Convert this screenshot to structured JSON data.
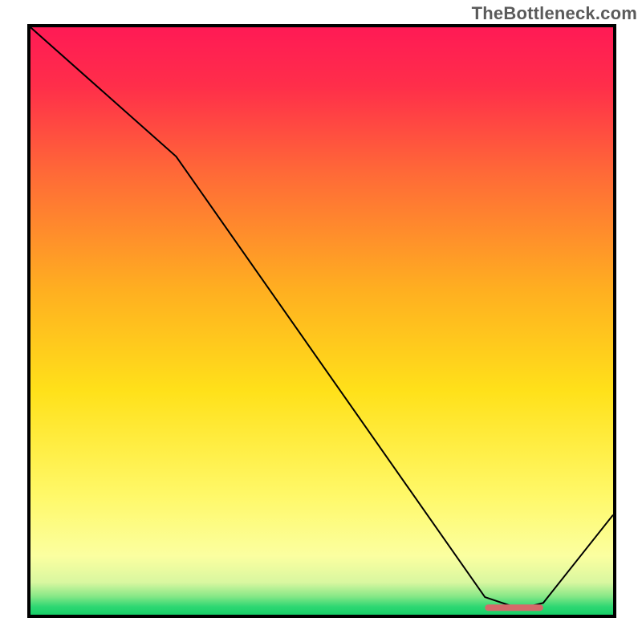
{
  "watermark": "TheBottleneck.com",
  "chart_data": {
    "type": "line",
    "title": "",
    "xlabel": "",
    "ylabel": "",
    "xlim": [
      0,
      100
    ],
    "ylim": [
      0,
      100
    ],
    "x": [
      0,
      25,
      78,
      84,
      88,
      100
    ],
    "values": [
      100,
      78,
      3,
      1,
      2,
      17
    ],
    "gradient_stops": [
      {
        "offset": 0.0,
        "color": "#ff1a55"
      },
      {
        "offset": 0.1,
        "color": "#ff2e4a"
      },
      {
        "offset": 0.25,
        "color": "#ff6a37"
      },
      {
        "offset": 0.45,
        "color": "#ffb020"
      },
      {
        "offset": 0.62,
        "color": "#ffe11a"
      },
      {
        "offset": 0.8,
        "color": "#fff96a"
      },
      {
        "offset": 0.9,
        "color": "#fbffa0"
      },
      {
        "offset": 0.945,
        "color": "#d9f7a0"
      },
      {
        "offset": 0.968,
        "color": "#8ae888"
      },
      {
        "offset": 0.986,
        "color": "#2fd873"
      },
      {
        "offset": 1.0,
        "color": "#15cf67"
      }
    ],
    "marker": {
      "x_start": 78,
      "x_end": 88,
      "y": 1.2,
      "color": "#d46a6a"
    }
  }
}
